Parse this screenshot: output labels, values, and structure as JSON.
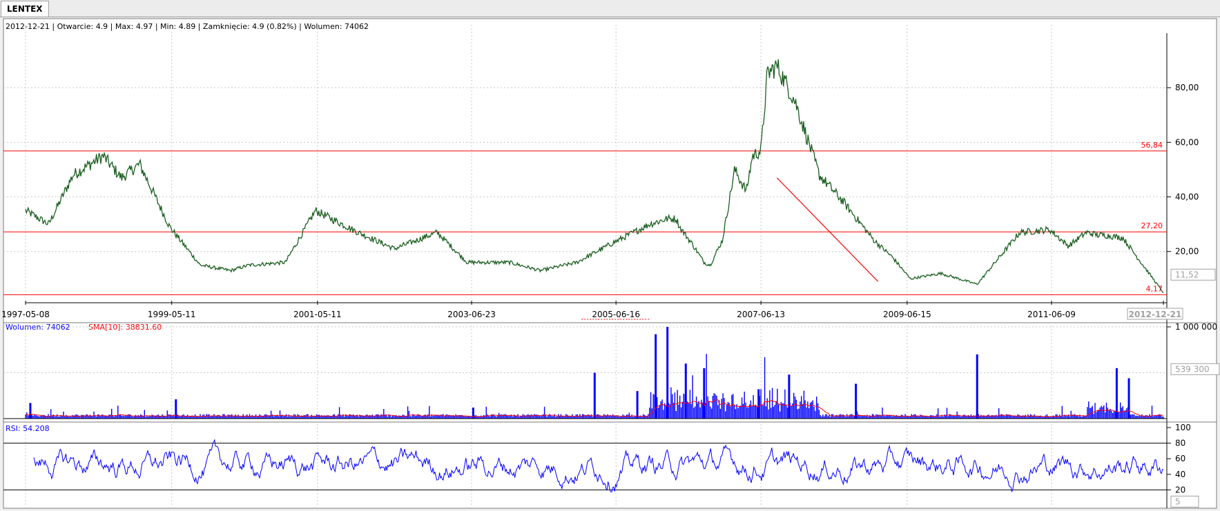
{
  "tab": {
    "label": "LENTEX"
  },
  "info": {
    "text": "2012-12-21 | Otwarcie: 4.9 | Max: 4.97 | Min: 4.89 | Zamknięcie: 4.9 (0.82%)  | Wolumen: 74062"
  },
  "chart_data": [
    {
      "type": "line",
      "panel": "price",
      "x_start": "1997-05-08",
      "x_end": "2012-12-21",
      "x_ticks": [
        "1997-05-08",
        "1999-05-11",
        "2001-05-11",
        "2003-06-23",
        "2005-06-16",
        "2007-06-13",
        "2009-06-15",
        "2011-06-09",
        "2012-12-21"
      ],
      "y_ticks": [
        "20,00",
        "40,00",
        "60,00",
        "80,00"
      ],
      "y_tick_values": [
        20,
        40,
        60,
        80
      ],
      "ylim": [
        3,
        100
      ],
      "current_value_label": "11,52",
      "horizontal_lines": [
        {
          "label": "56,84",
          "value": 56.84
        },
        {
          "label": "27,20",
          "value": 27.2
        },
        {
          "label": "4,17",
          "value": 4.17
        }
      ],
      "trendline": {
        "from": [
          "2007-09-01",
          47
        ],
        "to": [
          "2009-01-20",
          9
        ]
      },
      "series_color": "#1b5e20",
      "line_color": "#ff0000",
      "x": [
        "1997-05-08",
        "1997-09-01",
        "1998-01-01",
        "1998-06-01",
        "1998-09-01",
        "1998-12-01",
        "1999-05-01",
        "1999-10-01",
        "2000-03-01",
        "2000-06-01",
        "2000-12-01",
        "2001-05-01",
        "2001-12-01",
        "2002-06-01",
        "2003-01-01",
        "2003-06-01",
        "2004-01-01",
        "2004-06-01",
        "2004-12-01",
        "2005-05-01",
        "2005-12-01",
        "2006-03-01",
        "2006-04-15",
        "2006-05-01",
        "2006-07-01",
        "2006-09-01",
        "2006-10-01",
        "2006-12-01",
        "2007-02-01",
        "2007-04-01",
        "2007-05-01",
        "2007-06-13",
        "2007-07-15",
        "2007-09-01",
        "2007-12-01",
        "2008-04-01",
        "2008-08-01",
        "2009-01-01",
        "2009-04-01",
        "2009-07-01",
        "2009-12-01",
        "2010-06-01",
        "2011-01-01",
        "2011-06-01",
        "2011-09-01",
        "2011-12-01",
        "2012-02-01",
        "2012-03-01",
        "2012-06-01",
        "2012-12-21"
      ],
      "y": [
        35,
        30,
        48,
        55,
        47,
        52,
        29,
        15,
        13,
        15,
        16,
        35,
        27,
        21,
        27,
        16,
        16,
        13,
        16,
        22,
        30,
        32,
        32,
        29,
        23,
        16,
        15,
        24,
        50,
        42,
        55,
        57,
        85,
        88,
        75,
        48,
        38,
        24,
        18,
        10,
        12,
        8,
        27,
        28,
        22,
        27,
        26,
        26,
        25,
        4.9
      ]
    },
    {
      "type": "bar",
      "panel": "volume",
      "legend_volume": "Wolumen: 74062",
      "legend_sma": "SMA[10]: 38831.60",
      "y_ticks": [
        "1 000 000"
      ],
      "current_value_label": "539 300",
      "ylim": [
        0,
        1000000
      ],
      "bar_color": "#0000ff",
      "sma_color": "#ff0000",
      "spikes": [
        {
          "date": "1997-06-01",
          "value": 170000
        },
        {
          "date": "1999-06-01",
          "value": 210000
        },
        {
          "date": "2003-07-01",
          "value": 120000
        },
        {
          "date": "2005-03-01",
          "value": 500000
        },
        {
          "date": "2005-10-01",
          "value": 300000
        },
        {
          "date": "2006-01-01",
          "value": 920000
        },
        {
          "date": "2006-03-01",
          "value": 1000000
        },
        {
          "date": "2006-06-01",
          "value": 600000
        },
        {
          "date": "2006-09-01",
          "value": 550000
        },
        {
          "date": "2007-06-01",
          "value": 320000
        },
        {
          "date": "2007-11-01",
          "value": 480000
        },
        {
          "date": "2008-10-01",
          "value": 380000
        },
        {
          "date": "2010-06-01",
          "value": 700000
        },
        {
          "date": "2012-05-01",
          "value": 550000
        },
        {
          "date": "2012-07-01",
          "value": 440000
        }
      ]
    },
    {
      "type": "line",
      "panel": "rsi",
      "legend": "RSI: 54.208",
      "y_ticks": [
        "20",
        "40",
        "60",
        "80",
        "100"
      ],
      "y_tick_values": [
        20,
        40,
        60,
        80,
        100
      ],
      "ylim": [
        0,
        100
      ],
      "current_value_label": "5",
      "reference_lines": [
        80,
        20
      ],
      "series_color": "#0000ff"
    }
  ],
  "colors": {
    "price": "#1b5e20",
    "levels": "#ff0000",
    "volume": "#0000ff",
    "rsi": "#0000ff"
  }
}
